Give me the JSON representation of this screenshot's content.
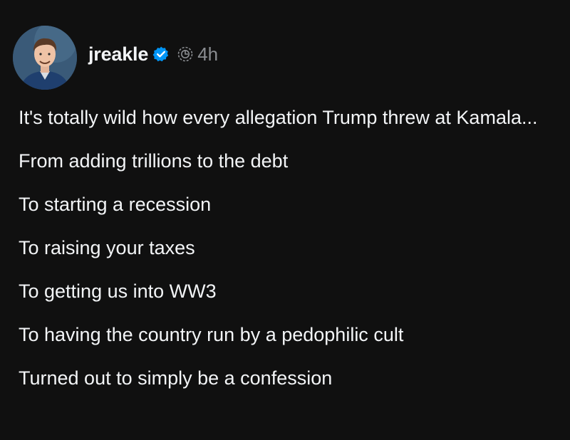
{
  "post": {
    "author": {
      "username": "jreakle",
      "verified": true,
      "avatar_icon": "profile-photo",
      "badge_icon": "verified-badge-icon",
      "thread_icon": "threads-icon"
    },
    "timestamp": "4h",
    "paragraphs": [
      "It's totally wild how every allegation Trump threw at Kamala...",
      "From adding trillions to the debt",
      "To starting a recession",
      "To raising your taxes",
      "To getting us into WW3",
      "To having the country run by a pedophilic cult",
      "Turned out to simply be a confession"
    ]
  },
  "colors": {
    "background": "#101010",
    "text": "#f3f5f7",
    "muted": "#8a8d91",
    "verified": "#0095f6"
  }
}
